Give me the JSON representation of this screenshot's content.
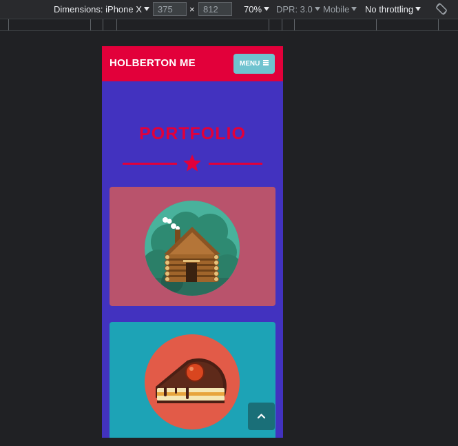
{
  "devtools": {
    "dimensions_label": "Dimensions: iPhone X",
    "width_value": "375",
    "times": "×",
    "height_value": "812",
    "zoom": "70%",
    "dpr": "DPR: 3.0",
    "mobile": "Mobile",
    "throttling": "No throttling",
    "rotate_icon": "rotate-icon"
  },
  "page": {
    "brand": "HOLBERTON ME",
    "menu_label": "MENU",
    "section_title": "PORTFOLIO",
    "colors": {
      "nav": "#e2003a",
      "background": "#4232bf",
      "menu_button": "#6fc3cf",
      "card1": "#b9536c",
      "card2": "#1da3b6",
      "back_top": "#1a6f78"
    },
    "portfolio_items": [
      {
        "icon": "log-cabin-icon"
      },
      {
        "icon": "cake-slice-icon"
      }
    ],
    "back_to_top_icon": "chevron-up-icon"
  }
}
